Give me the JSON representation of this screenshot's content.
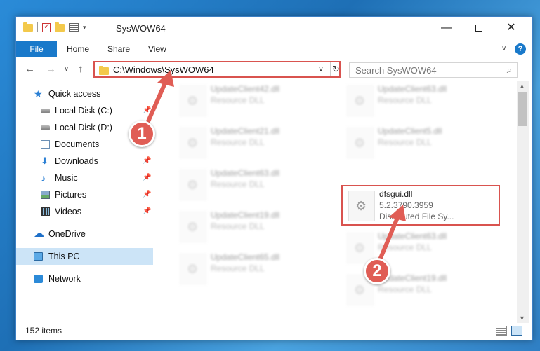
{
  "window": {
    "title": "SysWOW64",
    "controls": {
      "minimize": "—",
      "maximize": "",
      "close": "✕"
    }
  },
  "ribbon": {
    "tabs": [
      "File",
      "Home",
      "Share",
      "View"
    ],
    "help": "?"
  },
  "nav": {
    "back": "←",
    "forward": "→",
    "recent": "∨",
    "up": "↑",
    "address": "C:\\Windows\\SysWOW64",
    "address_caret": "∨",
    "refresh": "↻",
    "search_placeholder": "Search SysWOW64",
    "search_icon": "⌕"
  },
  "sidebar": {
    "items": [
      {
        "label": "Quick access",
        "icon": "star-icon"
      },
      {
        "label": "Local Disk (C:)",
        "icon": "disk-icon",
        "pinned": true
      },
      {
        "label": "Local Disk (D:)",
        "icon": "disk-icon"
      },
      {
        "label": "Documents",
        "icon": "documents-icon",
        "pinned": true
      },
      {
        "label": "Downloads",
        "icon": "download-icon",
        "pinned": true
      },
      {
        "label": "Music",
        "icon": "music-icon",
        "pinned": true
      },
      {
        "label": "Pictures",
        "icon": "pictures-icon",
        "pinned": true
      },
      {
        "label": "Videos",
        "icon": "videos-icon",
        "pinned": true
      },
      {
        "label": "OneDrive",
        "icon": "cloud-icon"
      },
      {
        "label": "This PC",
        "icon": "pc-icon",
        "selected": true
      },
      {
        "label": "Network",
        "icon": "network-icon"
      }
    ]
  },
  "files": [
    {
      "name": "UpdateClient42.dll",
      "type": "Resource DLL"
    },
    {
      "name": "UpdateClient63.dll",
      "type": "Resource DLL"
    },
    {
      "name": "UpdateClient21.dll",
      "type": "Resource DLL"
    },
    {
      "name": "UpdateClient5.dll",
      "type": "Resource DLL"
    },
    {
      "name": "UpdateClient63.dll",
      "type": "Resource DLL"
    },
    {
      "name": "dfsgui.dll",
      "version": "5.2.3790.3959",
      "type": "Distributed File Sy..."
    },
    {
      "name": "UpdateClient19.dll",
      "type": "Resource DLL"
    },
    {
      "name": "UpdateClient63.dll",
      "type": "Resource DLL"
    },
    {
      "name": "UpdateClient65.dll",
      "type": "Resource DLL"
    },
    {
      "name": "UpdateClient19.dll",
      "type": "Resource DLL"
    }
  ],
  "status": {
    "count": "152 items"
  },
  "annotations": {
    "step1": "1",
    "step2": "2"
  },
  "colors": {
    "accent": "#1979ca",
    "highlight": "#d9534f",
    "selection": "#cce4f7"
  }
}
